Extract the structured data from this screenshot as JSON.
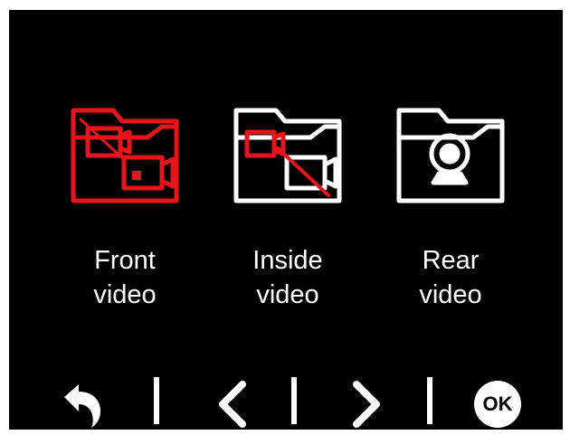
{
  "menu": {
    "items": [
      {
        "line1": "Front",
        "line2": "video",
        "selected": true,
        "icon": "folder-front-camera-icon"
      },
      {
        "line1": "Inside",
        "line2": "video",
        "selected": false,
        "icon": "folder-inside-camera-icon"
      },
      {
        "line1": "Rear",
        "line2": "video",
        "selected": false,
        "icon": "folder-webcam-icon"
      }
    ]
  },
  "softkeys": {
    "back": "back-arrow-icon",
    "prev": "chevron-left-icon",
    "next": "chevron-right-icon",
    "ok_label": "OK"
  },
  "colors": {
    "selected": "#e8141b",
    "normal": "#ffffff",
    "background": "#000000"
  }
}
